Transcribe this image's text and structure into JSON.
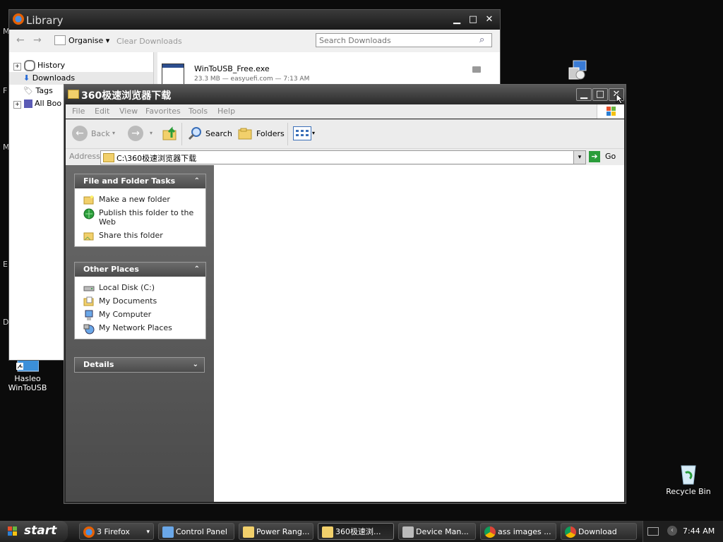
{
  "desktop": {
    "icons": [
      {
        "label": "Hasleo WinToUSB"
      },
      {
        "label": "Recycle Bin"
      }
    ],
    "edge_letters": [
      "M",
      "F",
      "M",
      "E",
      "D"
    ]
  },
  "library": {
    "title": "Library",
    "toolbar": {
      "organise": "Organise",
      "clear": "Clear Downloads",
      "search_placeholder": "Search Downloads"
    },
    "tree": [
      {
        "label": "History"
      },
      {
        "label": "Downloads"
      },
      {
        "label": "Tags"
      },
      {
        "label": "All Boo"
      }
    ],
    "download": {
      "name": "WinToUSB_Free.exe",
      "meta": "23.3 MB — easyuefi.com — 7:13 AM"
    }
  },
  "explorer": {
    "title": "360极速浏览器下载",
    "menu": [
      "File",
      "Edit",
      "View",
      "Favorites",
      "Tools",
      "Help"
    ],
    "toolbar": {
      "back": "Back",
      "search": "Search",
      "folders": "Folders"
    },
    "address": {
      "label": "Address",
      "path": "C:\\360极速浏览器下载",
      "go": "Go"
    },
    "panels": {
      "tasks": {
        "title": "File and Folder Tasks",
        "items": [
          {
            "label": "Make a new folder"
          },
          {
            "label": "Publish this folder to the Web"
          },
          {
            "label": "Share this folder"
          }
        ]
      },
      "places": {
        "title": "Other Places",
        "items": [
          {
            "label": "Local Disk (C:)"
          },
          {
            "label": "My Documents"
          },
          {
            "label": "My Computer"
          },
          {
            "label": "My Network Places"
          }
        ]
      },
      "details": {
        "title": "Details"
      }
    }
  },
  "taskbar": {
    "start": "start",
    "buttons": [
      {
        "label": "3 Firefox"
      },
      {
        "label": "Control Panel"
      },
      {
        "label": "Power Rang..."
      },
      {
        "label": "360极速浏..."
      },
      {
        "label": "Device Man..."
      },
      {
        "label": "ass images ..."
      },
      {
        "label": "Download"
      }
    ],
    "clock": "7:44 AM"
  }
}
